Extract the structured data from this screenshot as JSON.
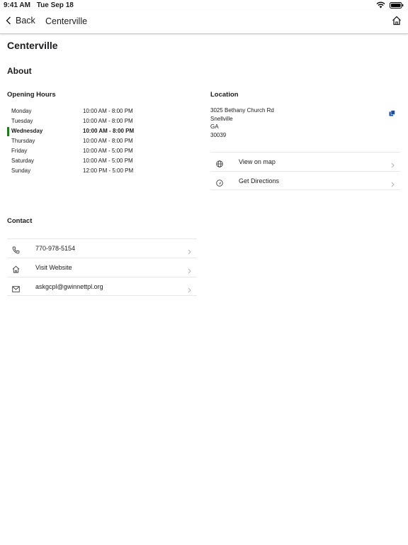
{
  "status_bar": {
    "time": "9:41 AM",
    "date": "Tue Sep 18"
  },
  "nav": {
    "back_label": "Back",
    "title": "Centerville"
  },
  "page": {
    "title": "Centerville",
    "about_heading": "About"
  },
  "hours": {
    "heading": "Opening Hours",
    "days": [
      {
        "day": "Monday",
        "time": "10:00 AM - 8:00 PM"
      },
      {
        "day": "Tuesday",
        "time": "10:00 AM - 8:00 PM"
      },
      {
        "day": "Wednesday",
        "time": "10:00 AM - 8:00 PM"
      },
      {
        "day": "Thursday",
        "time": "10:00 AM - 8:00 PM"
      },
      {
        "day": "Friday",
        "time": "10:00 AM - 5:00 PM"
      },
      {
        "day": "Saturday",
        "time": "10:00 AM - 5:00 PM"
      },
      {
        "day": "Sunday",
        "time": "12:00 PM - 5:00 PM"
      }
    ],
    "current_day": "Wednesday",
    "current_color": "#1a7f1a"
  },
  "location": {
    "heading": "Location",
    "address_lines": [
      "3025 Bethany Church Rd",
      "Snellville",
      "GA",
      "30039"
    ],
    "actions": [
      {
        "label": "View on map",
        "icon": "globe-icon"
      },
      {
        "label": "Get Directions",
        "icon": "directions-icon"
      }
    ],
    "copy_icon_color": "#1f4e9c"
  },
  "contact": {
    "heading": "Contact",
    "items": [
      {
        "label": "770-978-5154",
        "icon": "phone-icon"
      },
      {
        "label": "Visit Website",
        "icon": "home-icon"
      },
      {
        "label": "askgcpl@gwinnettpl.org",
        "icon": "mail-icon"
      }
    ]
  }
}
